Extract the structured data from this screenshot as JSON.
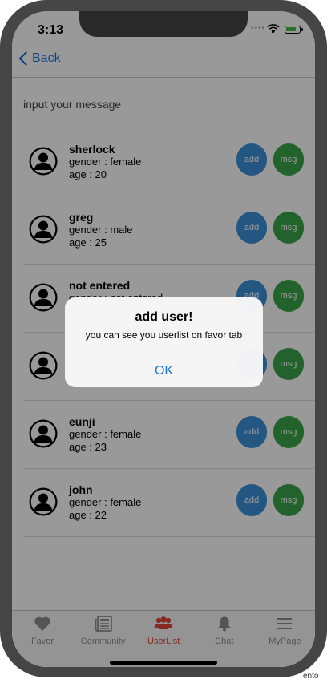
{
  "status_bar": {
    "time": "3:13",
    "dots": "••••"
  },
  "navbar": {
    "back_label": "Back"
  },
  "message_input": {
    "placeholder": "input your message"
  },
  "users": [
    {
      "name": "sherlock",
      "gender": "gender : female",
      "age": "age : 20"
    },
    {
      "name": "greg",
      "gender": "gender : male",
      "age": "age : 25"
    },
    {
      "name": "not entered",
      "gender": "gender : not entered",
      "age": ""
    },
    {
      "name": "",
      "gender": "",
      "age": ""
    },
    {
      "name": "eunji",
      "gender": "gender : female",
      "age": "age : 23"
    },
    {
      "name": "john",
      "gender": "gender : female",
      "age": "age : 22"
    }
  ],
  "row_buttons": {
    "add_label": "add",
    "msg_label": "msg"
  },
  "alert": {
    "title": "add user!",
    "message": "you can see you userlist on favor tab",
    "ok_label": "OK"
  },
  "tabs": [
    {
      "label": "Favor",
      "icon": "heart-icon"
    },
    {
      "label": "Community",
      "icon": "newspaper-icon"
    },
    {
      "label": "UserList",
      "icon": "users-icon"
    },
    {
      "label": "Chat",
      "icon": "bell-icon"
    },
    {
      "label": "MyPage",
      "icon": "menu-icon"
    }
  ],
  "active_tab": "UserList",
  "colors": {
    "accent": "#1a73d9",
    "add_button": "#3c8fd9",
    "msg_button": "#3aa648",
    "active_tab": "#e0453a"
  },
  "side_text": "ento"
}
